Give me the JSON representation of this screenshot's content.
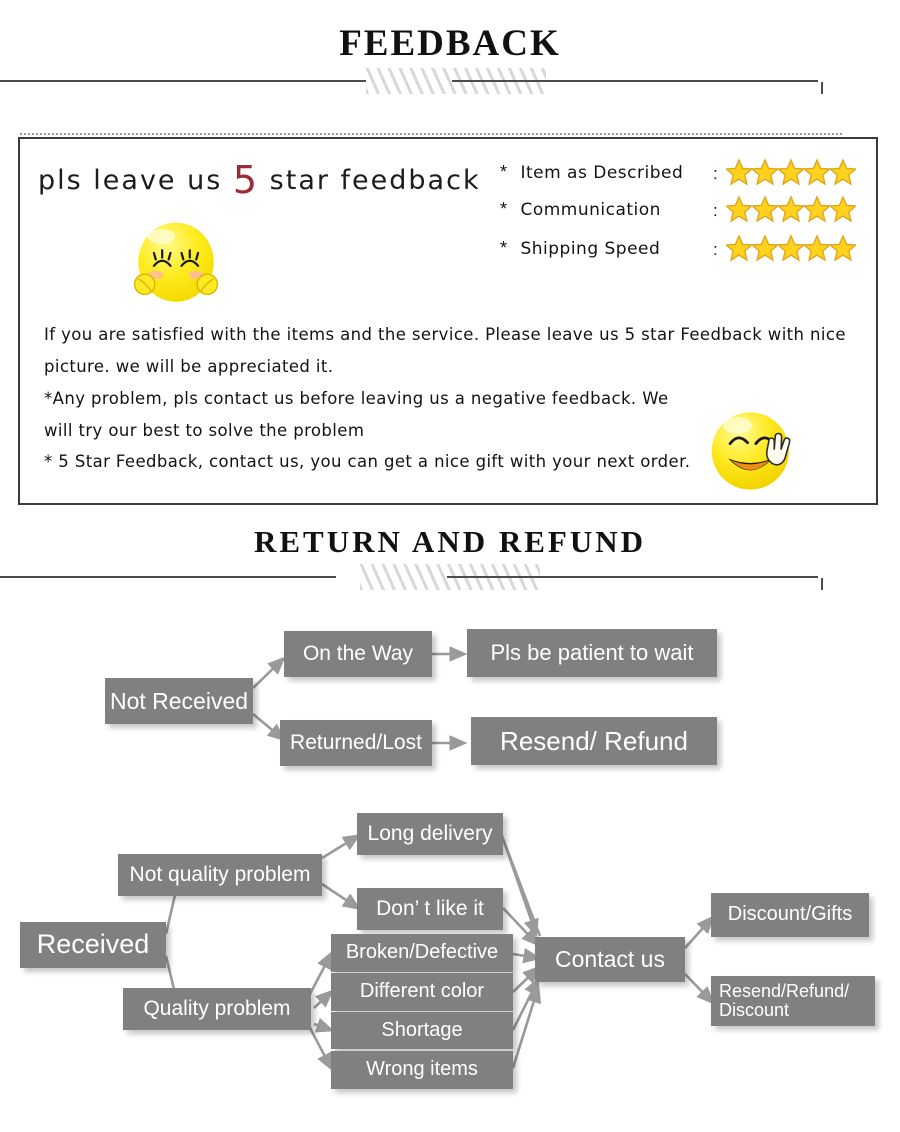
{
  "sections": {
    "feedback_title": "FEEDBACK",
    "return_title": "RETURN  AND  REFUND"
  },
  "feedback": {
    "headline_before": "pls leave us ",
    "headline_number": "5",
    "headline_after": " star feedback",
    "asterisk": "*",
    "colon": ":",
    "ratings": [
      {
        "label": "Item as Described",
        "stars": 5
      },
      {
        "label": "Communication",
        "stars": 5
      },
      {
        "label": "Shipping Speed",
        "stars": 5
      }
    ],
    "body": [
      "If you are satisfied with the items and the service. Please leave us 5 star Feedback with nice",
      "picture. we will be appreciated it.",
      "*Any problem, pls contact us before leaving us a negative feedback. We",
      "will try our best to solve  the problem",
      "* 5 Star Feedback, contact us, you can get a nice gift with your next order."
    ],
    "smiley_1": "smiley-closed-eyes-hands",
    "smiley_2": "smiley-peace-sign"
  },
  "flowchart": {
    "not_received": {
      "root": "Not Received",
      "branches": [
        "On the Way",
        "Returned/Lost"
      ],
      "outcomes": [
        "Pls be patient to wait",
        "Resend/ Refund"
      ]
    },
    "received": {
      "root": "Received",
      "not_quality": "Not quality problem",
      "quality": "Quality problem",
      "not_quality_reasons": [
        "Long delivery",
        "Don’ t like it"
      ],
      "quality_reasons": [
        "Broken/Defective",
        "Different color",
        "Shortage",
        "Wrong items"
      ],
      "contact": "Contact us",
      "results": [
        "Discount/Gifts",
        "Resend/Refund/\nDiscount"
      ]
    }
  },
  "colors": {
    "node_fill": "#808080",
    "node_text": "#ffffff",
    "arrow": "#9a9a9a",
    "star": "#ffd21e",
    "star_stroke": "#e0a61c",
    "accent_red": "#9e2a33",
    "rule": "#4c4c4c"
  }
}
